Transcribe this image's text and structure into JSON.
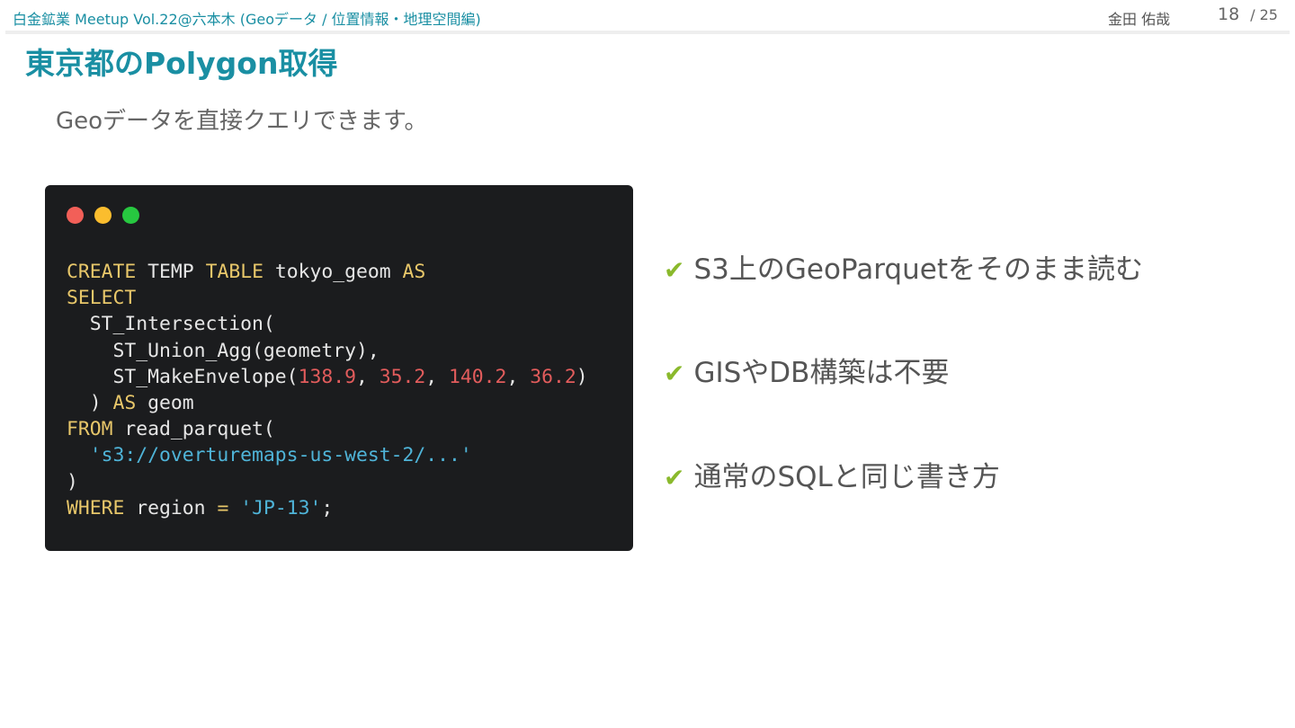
{
  "header": {
    "event": "白金鉱業 Meetup Vol.22@六本木 (Geoデータ / 位置情報・地理空間編)",
    "author": "金田 佑哉",
    "page_current": "18",
    "page_separator": "/",
    "page_total": "25"
  },
  "slide": {
    "title": "東京都のPolygon取得",
    "subtitle": "Geoデータを直接クエリできます。"
  },
  "code_window": {
    "language": "SQL",
    "colors": {
      "keyword": "#e8c76a",
      "number": "#e25c5c",
      "string": "#4fb4d8",
      "text": "#e6e6e6",
      "background": "#1b1c1e"
    },
    "tokens": {
      "create": "CREATE",
      "temp": " TEMP ",
      "table": "TABLE",
      "tokyo_geom": " tokyo_geom ",
      "as1": "AS",
      "select": "SELECT",
      "intersection": "  ST_Intersection(",
      "union_agg": "    ST_Union_Agg(geometry),",
      "make_envelope": "    ST_MakeEnvelope(",
      "n1": "138.9",
      "c1": ", ",
      "n2": "35.2",
      "c2": ", ",
      "n3": "140.2",
      "c3": ", ",
      "n4": "36.2",
      "close1": ")",
      "close_paren_indent": "  ) ",
      "as2": "AS",
      "geom": " geom",
      "from": "FROM",
      "read_parquet": " read_parquet(",
      "s3_path": "  's3://overturemaps-us-west-2/...'",
      "close2": ")",
      "where": "WHERE",
      "region": " region ",
      "eq": "=",
      "sp": " ",
      "region_val": "'JP-13'",
      "semicolon": ";"
    }
  },
  "bullets": {
    "check_icon": "✔",
    "check_color": "#8ab92c",
    "items": [
      "S3上のGeoParquetをそのまま読む",
      "GISやDB構築は不要",
      "通常のSQLと同じ書き方"
    ]
  }
}
